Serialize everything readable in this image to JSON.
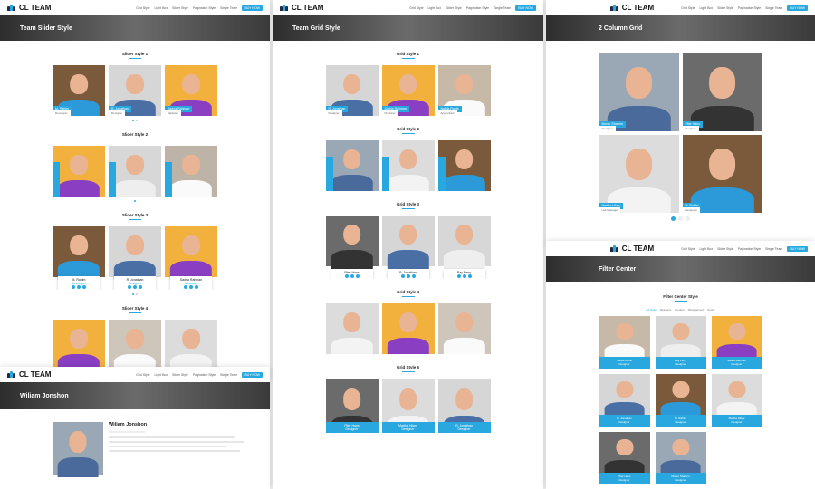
{
  "brand": {
    "name": "CL TEAM",
    "accent": "#29a8e0"
  },
  "nav": {
    "items": [
      "Grid Style",
      "Light Box",
      "Slider Style",
      "Pagination Style",
      "Single Team"
    ],
    "buy": "BUY NOW"
  },
  "slider_page": {
    "hero": "Team Slider Style",
    "s1": {
      "title": "Slider Style 1",
      "cards": [
        {
          "name": "M. Rahim",
          "role": "Developer"
        },
        {
          "name": "R. Jonathan",
          "role": "Designer"
        },
        {
          "name": "Sadria Rahman",
          "role": "Marketer"
        }
      ]
    },
    "s2": {
      "title": "Slider Style 2"
    },
    "s3": {
      "title": "Slider Style 3",
      "cards": [
        {
          "name": "M. Rahim",
          "role": "Developer"
        },
        {
          "name": "R. Jonathan",
          "role": "Designer"
        },
        {
          "name": "Sadria Rahman",
          "role": "Marketer"
        }
      ]
    },
    "s4": {
      "title": "Slider Style 4"
    }
  },
  "grid_page": {
    "hero": "Team Grid Style",
    "g1": {
      "title": "Grid Style 1",
      "cards": [
        {
          "name": "R. Jonathan",
          "role": "Designer"
        },
        {
          "name": "Sadria Rahman",
          "role": "Producer"
        },
        {
          "name": "Nabila Rahib",
          "role": "Accountant"
        }
      ]
    },
    "g2": {
      "title": "Grid Style 2"
    },
    "g3": {
      "title": "Grid Style 3",
      "cards": [
        {
          "name": "Piter Hans",
          "role": ""
        },
        {
          "name": "R. Jonathan",
          "role": ""
        },
        {
          "name": "Ray Perry",
          "role": ""
        }
      ]
    },
    "g4": {
      "title": "Grid Style 4"
    },
    "g5": {
      "title": "Grid Style 5",
      "cards": [
        {
          "name": "Piter Hans",
          "role": "Designer"
        },
        {
          "name": "Martha Hilary",
          "role": "Designer"
        },
        {
          "name": "R. Jonathan",
          "role": "Designer"
        }
      ]
    }
  },
  "column_page": {
    "hero": "2 Column Grid",
    "cards": [
      {
        "name": "Moner Shaikim",
        "role": "Designer"
      },
      {
        "name": "Piter Hans",
        "role": "Designer"
      },
      {
        "name": "Martha Hilary",
        "role": "Lab Manager"
      },
      {
        "name": "M. Rahim",
        "role": "Developer"
      }
    ]
  },
  "filter_page": {
    "hero": "Filter Center",
    "title": "Filter Center Style",
    "tabs": [
      "All Team",
      "Business",
      "Product",
      "Management",
      "Social"
    ],
    "cards": [
      {
        "name": "Nabila Rahib",
        "role": "Designer"
      },
      {
        "name": "Ray Perry",
        "role": "Designer"
      },
      {
        "name": "Sadria Rahman",
        "role": "Designer"
      },
      {
        "name": "R. Jonathan",
        "role": "Designer"
      },
      {
        "name": "M. Rahim",
        "role": "Designer"
      },
      {
        "name": "Martha Hilary",
        "role": "Designer"
      },
      {
        "name": "Piter Hans",
        "role": "Designer"
      },
      {
        "name": "Moner Shaikim",
        "role": "Designer"
      }
    ]
  },
  "single_page": {
    "hero": "Wiliam Jonshon",
    "name": "Wiliam Jonshon"
  }
}
